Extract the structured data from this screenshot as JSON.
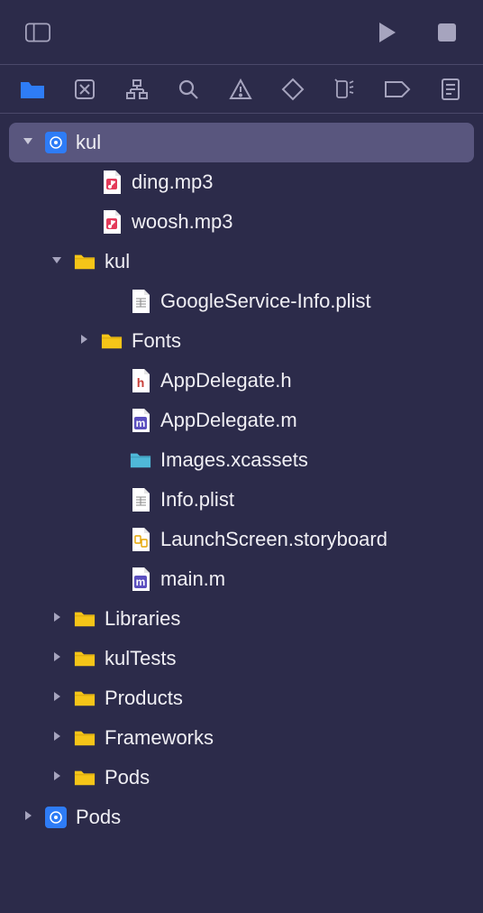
{
  "colors": {
    "bg": "#2C2B4A",
    "selection": "#59567E",
    "active_blue": "#2E7CF6",
    "icon_muted": "#A6A4BE",
    "folder_yellow": "#F5C518"
  },
  "tree": {
    "root": {
      "label": "kul",
      "icon": "app-project-icon",
      "expanded": true
    },
    "items": [
      {
        "label": "ding.mp3",
        "icon": "audio-file-icon"
      },
      {
        "label": "woosh.mp3",
        "icon": "audio-file-icon"
      },
      {
        "label": "kul",
        "icon": "folder-icon",
        "expanded": true
      },
      {
        "label": "GoogleService-Info.plist",
        "icon": "plist-file-icon"
      },
      {
        "label": "Fonts",
        "icon": "folder-icon",
        "expanded": false
      },
      {
        "label": "AppDelegate.h",
        "icon": "header-file-icon"
      },
      {
        "label": "AppDelegate.m",
        "icon": "impl-file-icon"
      },
      {
        "label": "Images.xcassets",
        "icon": "assets-folder-icon"
      },
      {
        "label": "Info.plist",
        "icon": "plist-file-icon"
      },
      {
        "label": "LaunchScreen.storyboard",
        "icon": "storyboard-file-icon"
      },
      {
        "label": "main.m",
        "icon": "impl-file-icon"
      },
      {
        "label": "Libraries",
        "icon": "folder-icon",
        "expanded": false
      },
      {
        "label": "kulTests",
        "icon": "folder-icon",
        "expanded": false
      },
      {
        "label": "Products",
        "icon": "folder-icon",
        "expanded": false
      },
      {
        "label": "Frameworks",
        "icon": "folder-icon",
        "expanded": false
      },
      {
        "label": "Pods",
        "icon": "folder-icon",
        "expanded": false
      },
      {
        "label": "Pods",
        "icon": "pods-project-icon",
        "expanded": false
      }
    ]
  }
}
